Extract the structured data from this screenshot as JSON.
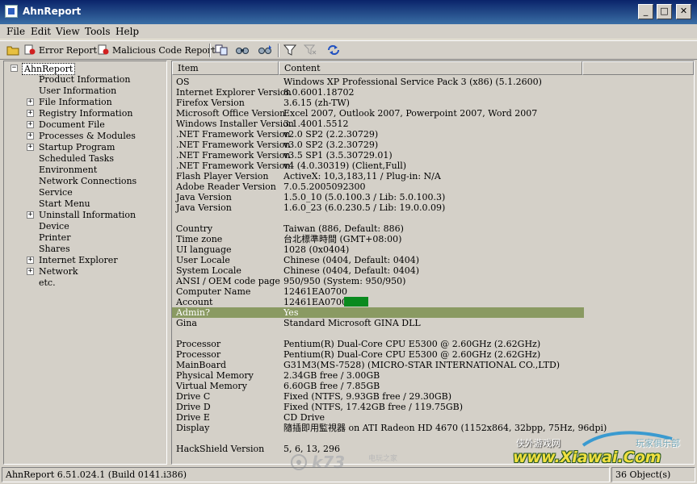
{
  "window": {
    "title": "AhnReport"
  },
  "menu": [
    "File",
    "Edit",
    "View",
    "Tools",
    "Help"
  ],
  "toolbar": {
    "error_report": "Error Report",
    "malicious_report": "Malicious Code Report"
  },
  "tree": {
    "root": "AhnReport",
    "items": [
      "Product Information",
      "User Information",
      "File Information",
      "Registry Information",
      "Document File",
      "Processes & Modules",
      "Startup Program",
      "Scheduled Tasks",
      "Environment",
      "Network Connections",
      "Service",
      "Start Menu",
      "Uninstall Information",
      "Device",
      "Printer",
      "Shares",
      "Internet Explorer",
      "Network",
      "etc."
    ]
  },
  "columns": {
    "item": "Item",
    "content": "Content"
  },
  "rows": [
    {
      "k": "OS",
      "v": "Windows XP Professional Service Pack 3 (x86) (5.1.2600)"
    },
    {
      "k": "Internet Explorer Version",
      "v": "8.0.6001.18702"
    },
    {
      "k": "Firefox Version",
      "v": "3.6.15 (zh-TW)"
    },
    {
      "k": "Microsoft Office Version",
      "v": "Excel 2007, Outlook 2007, Powerpoint 2007, Word 2007"
    },
    {
      "k": "Windows Installer Version",
      "v": "3.1.4001.5512"
    },
    {
      "k": ".NET Framework Version",
      "v": "v2.0 SP2 (2.2.30729)"
    },
    {
      "k": ".NET Framework Version",
      "v": "v3.0 SP2 (3.2.30729)"
    },
    {
      "k": ".NET Framework Version",
      "v": "v3.5 SP1 (3.5.30729.01)"
    },
    {
      "k": ".NET Framework Version",
      "v": "v4 (4.0.30319) (Client,Full)"
    },
    {
      "k": "Flash Player Version",
      "v": "ActiveX: 10,3,183,11 / Plug-in: N/A"
    },
    {
      "k": "Adobe Reader Version",
      "v": "7.0.5.2005092300"
    },
    {
      "k": "Java Version",
      "v": "1.5.0_10 (5.0.100.3 / Lib: 5.0.100.3)"
    },
    {
      "k": "Java Version",
      "v": "1.6.0_23 (6.0.230.5 / Lib: 19.0.0.09)"
    },
    {
      "k": "",
      "v": ""
    },
    {
      "k": "Country",
      "v": "Taiwan (886, Default: 886)"
    },
    {
      "k": "Time zone",
      "v": "台北標準時間 (GMT+08:00)"
    },
    {
      "k": "UI language",
      "v": "1028 (0x0404)"
    },
    {
      "k": "User Locale",
      "v": "Chinese (0404, Default: 0404)"
    },
    {
      "k": "System Locale",
      "v": "Chinese (0404, Default: 0404)"
    },
    {
      "k": "ANSI / OEM code page",
      "v": "950/950 (System: 950/950)"
    },
    {
      "k": "Computer Name",
      "v": "12461EA0700"
    },
    {
      "k": "Account",
      "v": "12461EA0700\\"
    },
    {
      "k": "Admin?",
      "v": "Yes"
    },
    {
      "k": "Gina",
      "v": "Standard Microsoft GINA DLL"
    },
    {
      "k": "",
      "v": ""
    },
    {
      "k": "Processor",
      "v": "Pentium(R) Dual-Core  CPU     E5300  @ 2.60GHz (2.62GHz)"
    },
    {
      "k": "Processor",
      "v": "Pentium(R) Dual-Core  CPU     E5300  @ 2.60GHz (2.62GHz)"
    },
    {
      "k": "MainBoard",
      "v": "G31M3(MS-7528) (MICRO-STAR INTERNATIONAL CO.,LTD)"
    },
    {
      "k": "Physical Memory",
      "v": "2.34GB free / 3.00GB"
    },
    {
      "k": "Virtual Memory",
      "v": "6.60GB free / 7.85GB"
    },
    {
      "k": "Drive C",
      "v": "Fixed (NTFS, 9.93GB free / 29.30GB)"
    },
    {
      "k": "Drive D",
      "v": "Fixed (NTFS, 17.42GB free / 119.75GB)"
    },
    {
      "k": "Drive E",
      "v": "CD Drive"
    },
    {
      "k": "Display",
      "v": "隨插即用監視器 on ATI Radeon HD 4670 (1152x864, 32bpp, 75Hz, 96dpi)"
    },
    {
      "k": "",
      "v": ""
    },
    {
      "k": "HackShield Version",
      "v": "5, 6, 13, 296"
    }
  ],
  "status": {
    "version": "AhnReport 6.51.024.1 (Build 0141.i386)",
    "count": "36 Object(s)"
  },
  "watermarks": {
    "site_cn": "侠外游戏网",
    "site_en": "www.Xiawai.Com",
    "club": "玩家俱乐部",
    "k73": "k73",
    "k73_cn": "电玩之家"
  }
}
